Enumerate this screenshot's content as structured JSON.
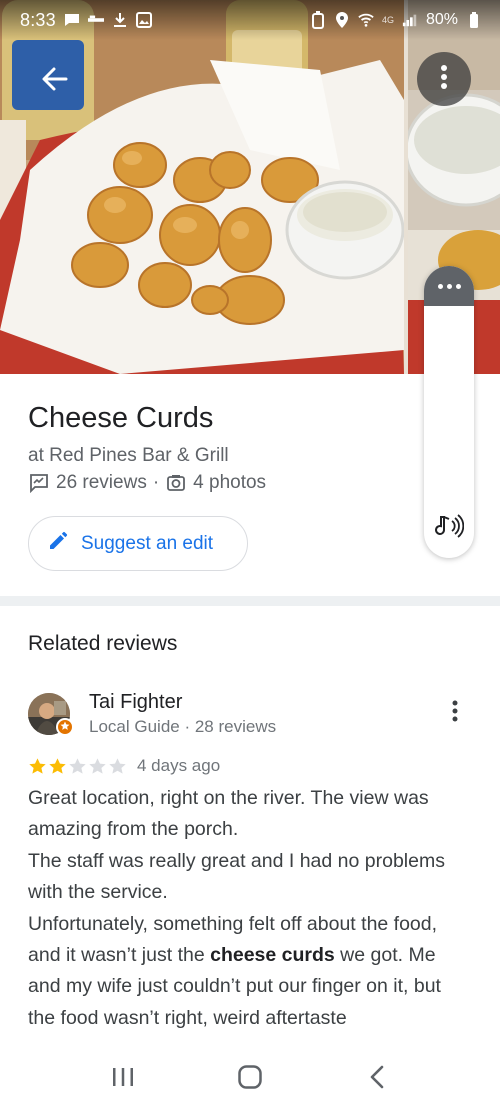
{
  "status_bar": {
    "time": "8:33",
    "network_label": "4G",
    "battery": "80%"
  },
  "place": {
    "title": "Cheese Curds",
    "subtitle": "at Red Pines Bar & Grill",
    "reviews_count": "26 reviews",
    "meta_separator": "·",
    "photos_count": "4 photos",
    "suggest_edit_label": "Suggest an edit"
  },
  "related": {
    "title": "Related reviews",
    "review": {
      "name": "Tai Fighter",
      "meta": "Local Guide · 28 reviews",
      "rating": 2,
      "max_rating": 5,
      "date": "4 days ago",
      "paragraphs": [
        {
          "text": "Great location, right on the river. The view was amazing from the porch."
        },
        {
          "text": "The staff was really great and I had no problems with the service."
        },
        {
          "before": "Unfortunately, something felt off about the food, and it wasn’t just the ",
          "highlight": "cheese curds",
          "after": " we got. Me and my wife just couldn’t put our finger on it, but the food wasn’t right, weird aftertaste"
        }
      ]
    }
  },
  "colors": {
    "accent": "#1a73e8",
    "star_filled": "#fbbc04",
    "star_empty": "#dadce0",
    "badge": "#e37400"
  },
  "icons": {
    "back": "arrow-left-icon",
    "more": "more-vert-icon",
    "reviews": "review-icon",
    "photos": "camera-icon",
    "edit": "pencil-icon",
    "audio": "audio-icon",
    "nav_recents": "recents-icon",
    "nav_home": "home-icon",
    "nav_back": "chevron-left-icon"
  }
}
